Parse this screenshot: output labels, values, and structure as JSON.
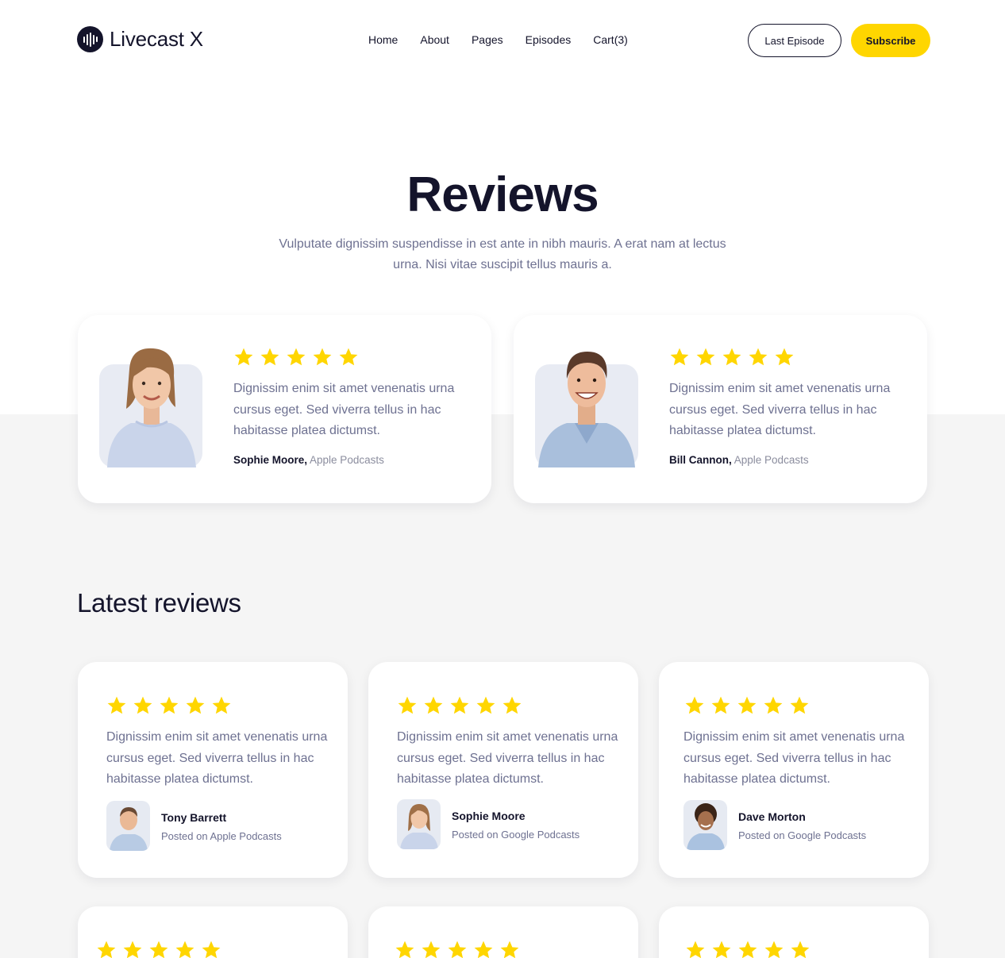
{
  "header": {
    "logo_text": "Livecast X",
    "nav": [
      "Home",
      "About",
      "Pages",
      "Episodes",
      "Cart(3)"
    ],
    "last_episode_label": "Last Episode",
    "subscribe_label": "Subscribe"
  },
  "hero": {
    "title": "Reviews",
    "subtitle": "Vulputate dignissim suspendisse in est ante in nibh mauris. A erat nam at lectus urna. Nisi vitae suscipit tellus mauris a."
  },
  "featured_reviews": [
    {
      "rating": 5,
      "text": "Dignissim enim sit amet venenatis urna cursus eget. Sed viverra tellus in hac habitasse platea dictumst.",
      "name": "Sophie Moore,",
      "source": "Apple Podcasts"
    },
    {
      "rating": 5,
      "text": "Dignissim enim sit amet venenatis urna cursus eget. Sed viverra tellus in hac habitasse platea dictumst.",
      "name": "Bill Cannon,",
      "source": "Apple Podcasts"
    }
  ],
  "latest": {
    "title": "Latest reviews",
    "reviews": [
      {
        "rating": 5,
        "text": "Dignissim enim sit amet venenatis urna cursus eget. Sed viverra tellus in hac habitasse platea dictumst.",
        "name": "Tony Barrett",
        "meta": "Posted on Apple Podcasts"
      },
      {
        "rating": 5,
        "text": "Dignissim enim sit amet venenatis urna cursus eget. Sed viverra tellus in hac habitasse platea dictumst.",
        "name": "Sophie Moore",
        "meta": "Posted on Google Podcasts"
      },
      {
        "rating": 5,
        "text": "Dignissim enim sit amet venenatis urna cursus eget. Sed viverra tellus in hac habitasse platea dictumst.",
        "name": "Dave Morton",
        "meta": "Posted on Google Podcasts"
      }
    ],
    "next_row_ratings": [
      5,
      5,
      5
    ]
  },
  "colors": {
    "accent": "#ffd600",
    "heading": "#14142b",
    "body_text": "#6e7191",
    "section_bg": "#f5f5f5"
  }
}
